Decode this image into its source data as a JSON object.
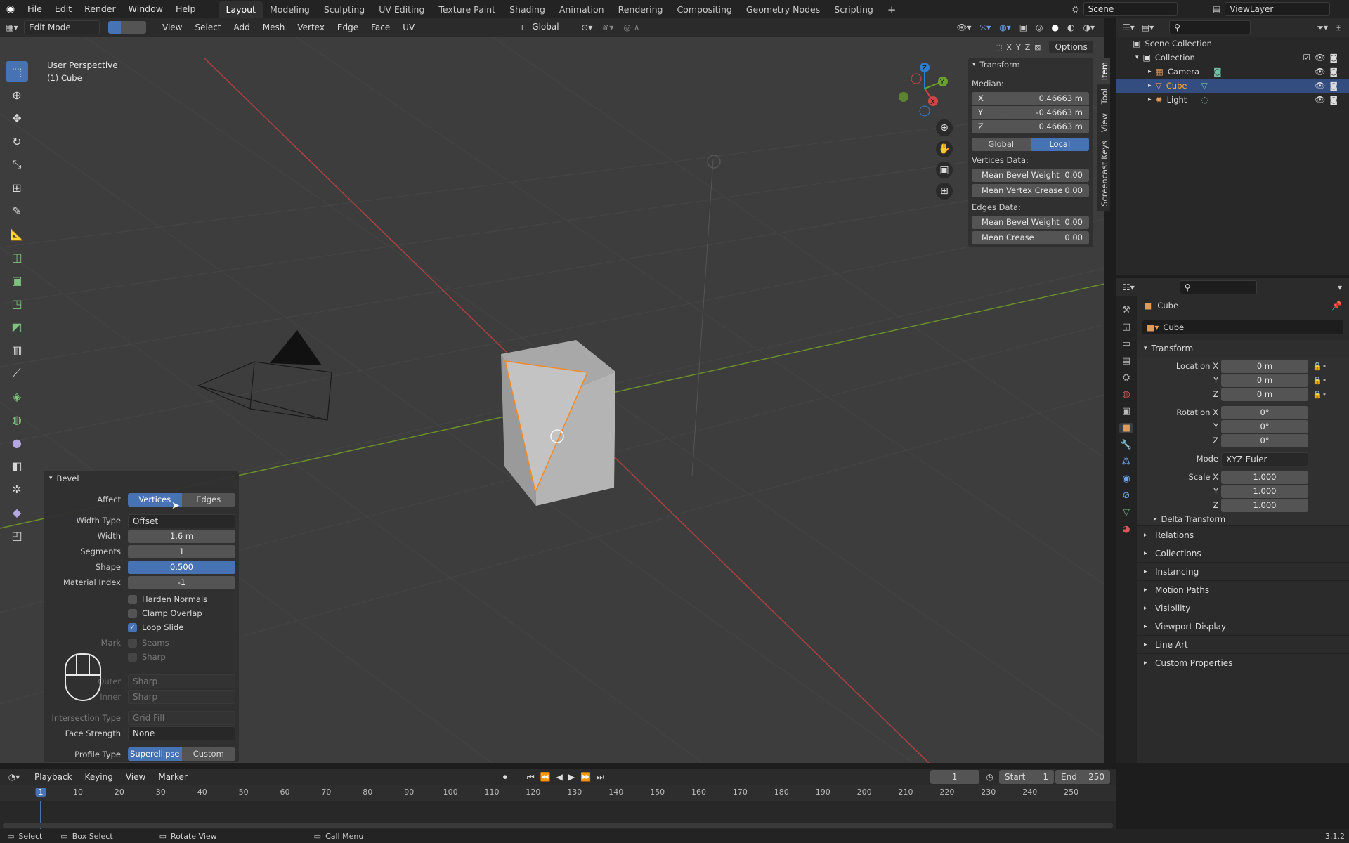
{
  "app": {
    "version": "3.1.2"
  },
  "menu": [
    "File",
    "Edit",
    "Render",
    "Window",
    "Help"
  ],
  "workspaces": [
    "Layout",
    "Modeling",
    "Sculpting",
    "UV Editing",
    "Texture Paint",
    "Shading",
    "Animation",
    "Rendering",
    "Compositing",
    "Geometry Nodes",
    "Scripting"
  ],
  "scene": {
    "name": "Scene",
    "view_layer": "ViewLayer"
  },
  "header": {
    "mode": "Edit Mode",
    "menus": [
      "View",
      "Select",
      "Add",
      "Mesh",
      "Vertex",
      "Edge",
      "Face",
      "UV"
    ],
    "orientation": "Global",
    "options": "Options",
    "axes": [
      "X",
      "Y",
      "Z"
    ]
  },
  "viewport": {
    "title": "User Perspective",
    "subtitle": "(1) Cube"
  },
  "npanel": {
    "section": "Transform",
    "median_label": "Median:",
    "x_label": "X",
    "x": "0.46663 m",
    "y_label": "Y",
    "y": "-0.46663 m",
    "z_label": "Z",
    "z": "0.46663 m",
    "global": "Global",
    "local": "Local",
    "vertices_data": "Vertices Data:",
    "mean_bevel_weight": "Mean Bevel Weight",
    "mean_bevel_weight_v": "0.00",
    "mean_vertex_crease": "Mean Vertex Crease",
    "mean_vertex_crease_v": "0.00",
    "edges_data": "Edges Data:",
    "mean_bevel_weight_e": "Mean Bevel Weight",
    "mean_bevel_weight_ev": "0.00",
    "mean_crease": "Mean Crease",
    "mean_crease_v": "0.00",
    "tabs": [
      "Item",
      "Tool",
      "View",
      "Screencast Keys"
    ]
  },
  "outliner": {
    "root": "Scene Collection",
    "collection": "Collection",
    "items": [
      "Camera",
      "Cube",
      "Light"
    ]
  },
  "properties": {
    "object": "Cube",
    "mesh": "Cube",
    "transform": "Transform",
    "location_x": "Location X",
    "loc": [
      "0 m",
      "0 m",
      "0 m"
    ],
    "rotation_x": "Rotation X",
    "rot": [
      "0°",
      "0°",
      "0°"
    ],
    "y": "Y",
    "z": "Z",
    "mode_label": "Mode",
    "mode": "XYZ Euler",
    "scale_x": "Scale X",
    "scale": [
      "1.000",
      "1.000",
      "1.000"
    ],
    "delta": "Delta Transform",
    "sections": [
      "Relations",
      "Collections",
      "Instancing",
      "Motion Paths",
      "Visibility",
      "Viewport Display",
      "Line Art",
      "Custom Properties"
    ]
  },
  "bevel": {
    "title": "Bevel",
    "affect": "Affect",
    "vertices": "Vertices",
    "edges": "Edges",
    "width_type": "Width Type",
    "width_type_v": "Offset",
    "width": "Width",
    "width_v": "1.6 m",
    "segments": "Segments",
    "segments_v": "1",
    "shape": "Shape",
    "shape_v": "0.500",
    "material_index": "Material Index",
    "material_index_v": "-1",
    "harden_normals": "Harden Normals",
    "clamp_overlap": "Clamp Overlap",
    "loop_slide": "Loop Slide",
    "mark": "Mark",
    "seams": "Seams",
    "sharp": "Sharp",
    "outer": "Outer",
    "outer_v": "Sharp",
    "inner": "Inner",
    "inner_v": "Sharp",
    "intersection_type": "Intersection Type",
    "intersection_type_v": "Grid Fill",
    "face_strength": "Face Strength",
    "face_strength_v": "None",
    "profile_type": "Profile Type",
    "superellipse": "Superellipse",
    "custom": "Custom"
  },
  "timeline": {
    "menus": [
      "Playback",
      "Keying",
      "View",
      "Marker"
    ],
    "frame": "1",
    "start_label": "Start",
    "start": "1",
    "end_label": "End",
    "end": "250",
    "ticks": [
      "1",
      "10",
      "20",
      "30",
      "40",
      "50",
      "60",
      "70",
      "80",
      "90",
      "100",
      "110",
      "120",
      "130",
      "140",
      "150",
      "160",
      "170",
      "180",
      "190",
      "200",
      "210",
      "220",
      "230",
      "240",
      "250"
    ]
  },
  "status": {
    "select": "Select",
    "box_select": "Box Select",
    "rotate_view": "Rotate View",
    "call_menu": "Call Menu"
  }
}
